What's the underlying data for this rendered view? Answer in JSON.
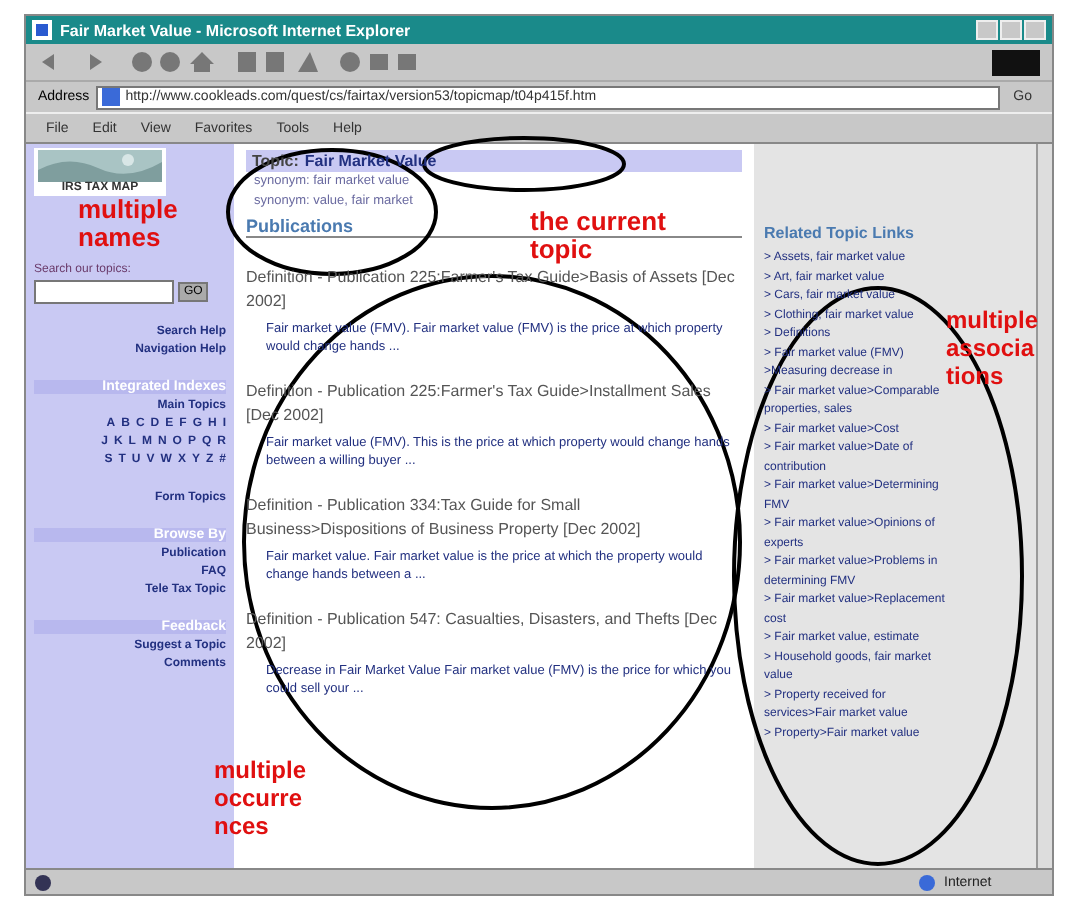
{
  "window": {
    "title": "Fair Market Value - Microsoft Internet Explorer"
  },
  "address_bar": {
    "label": "Address",
    "url": "http://www.cookleads.com/quest/cs/fairtax/version53/topicmap/t04p415f.htm",
    "go": "Go"
  },
  "menu": [
    "File",
    "Edit",
    "View",
    "Favorites",
    "Tools",
    "Help"
  ],
  "sidebar": {
    "logo_caption": "IRS TAX MAP",
    "search_label": "Search our topics:",
    "go_button": "GO",
    "help_links": [
      "Search Help",
      "Navigation Help"
    ],
    "sections": [
      {
        "header": "Integrated Indexes",
        "links": [
          "Main Topics"
        ],
        "letters": [
          [
            "A",
            "B",
            "C",
            "D",
            "E",
            "F",
            "G",
            "H",
            "I"
          ],
          [
            "J",
            "K",
            "L",
            "M",
            "N",
            "O",
            "P",
            "Q",
            "R"
          ],
          [
            "S",
            "T",
            "U",
            "V",
            "W",
            "X",
            "Y",
            "Z",
            "#"
          ]
        ],
        "after": [
          "Form Topics"
        ]
      },
      {
        "header": "Browse By",
        "links": [
          "Publication",
          "FAQ",
          "Tele Tax Topic"
        ]
      },
      {
        "header": "Feedback",
        "links": [
          "Suggest a Topic",
          "Comments"
        ]
      }
    ]
  },
  "topic": {
    "label": "Topic:",
    "name": "Fair Market Value",
    "synonyms": [
      "synonym: fair market value",
      "synonym: value, fair market"
    ]
  },
  "publications": {
    "heading": "Publications",
    "items": [
      {
        "title": "Definition - Publication 225:Farmer's Tax Guide>Basis of Assets [Dec 2002]",
        "excerpt": "Fair market value (FMV). Fair market value (FMV) is the price at which property would change hands ..."
      },
      {
        "title": "Definition - Publication 225:Farmer's Tax Guide>Installment Sales [Dec 2002]",
        "excerpt": "Fair market value (FMV). This is the price at which property would change hands between a willing buyer ..."
      },
      {
        "title": "Definition - Publication 334:Tax Guide for Small Business>Dispositions of Business Property [Dec 2002]",
        "excerpt": "Fair market value. Fair market value is the price at which the property would change hands between a ..."
      },
      {
        "title": "Definition - Publication 547: Casualties, Disasters, and Thefts [Dec 2002]",
        "excerpt": "Decrease in Fair Market Value Fair market value (FMV) is the price for which you could sell your ..."
      }
    ]
  },
  "related": {
    "heading": "Related Topic Links",
    "links": [
      "> Assets, fair market value",
      "> Art, fair market value",
      "> Cars, fair market value",
      "> Clothing, fair market value",
      "> Definitions",
      "> Fair market value (FMV) >Measuring decrease in",
      "> Fair market value>Comparable properties, sales",
      "> Fair market value>Cost",
      "> Fair market value>Date of contribution",
      "> Fair market value>Determining FMV",
      "> Fair market value>Opinions of experts",
      "> Fair market value>Problems in determining FMV",
      "> Fair market value>Replacement cost",
      "> Fair market value, estimate",
      "> Household goods, fair market value",
      "> Property received for services>Fair market value",
      "> Property>Fair market value"
    ]
  },
  "status_bar": {
    "zone": "Internet"
  },
  "annotations": [
    {
      "text": "multiple names",
      "kind": "names"
    },
    {
      "text": "the current topic",
      "kind": "topic"
    },
    {
      "text": "multiple associations",
      "kind": "associations"
    },
    {
      "text": "multiple occurrences",
      "kind": "occurrences"
    }
  ]
}
